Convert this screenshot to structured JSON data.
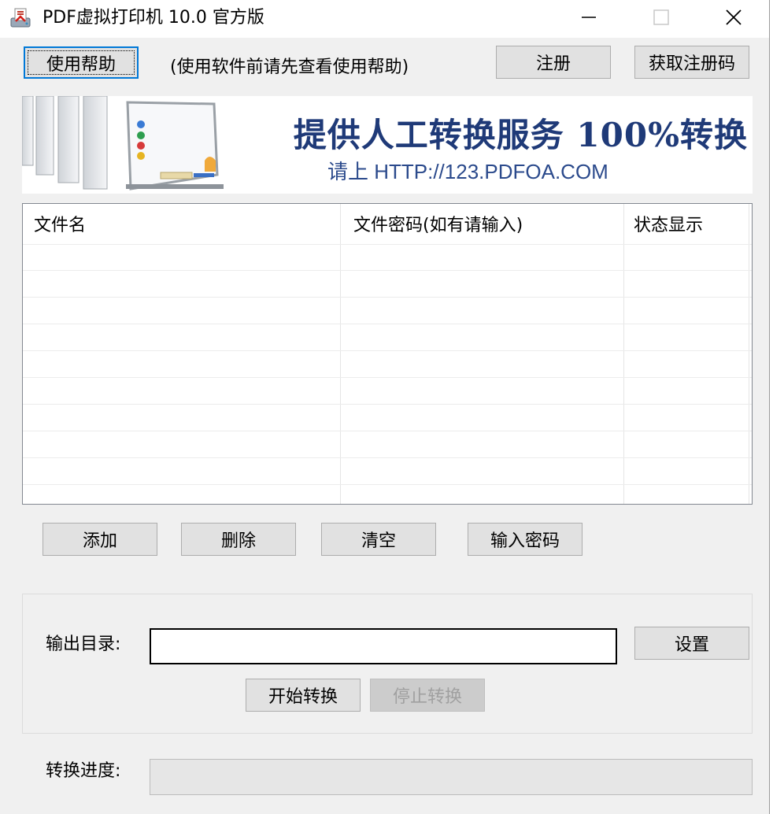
{
  "window": {
    "title": "PDF虚拟打印机 10.0 官方版",
    "minimize_icon": "minimize-icon",
    "maximize_icon": "maximize-icon",
    "close_icon": "close-icon"
  },
  "toolbar": {
    "help_label": "使用帮助",
    "help_hint": "(使用软件前请先查看使用帮助)",
    "register_label": "注册",
    "get_code_label": "获取注册码"
  },
  "banner": {
    "headline": "提供人工转换服务 100%转换",
    "subline": "请上  HTTP://123.PDFOA.COM"
  },
  "file_list": {
    "columns": [
      "文件名",
      "文件密码(如有请输入)",
      "状态显示"
    ],
    "rows": []
  },
  "list_actions": {
    "add_label": "添加",
    "delete_label": "删除",
    "clear_label": "清空",
    "password_label": "输入密码"
  },
  "output": {
    "dir_label": "输出目录:",
    "dir_value": "",
    "settings_label": "设置",
    "start_label": "开始转换",
    "stop_label": "停止转换"
  },
  "progress": {
    "label": "转换进度:",
    "value": 0
  },
  "colors": {
    "focus_border": "#0078d7",
    "banner_text": "#1f3a78",
    "progress_fill": "#06b025"
  }
}
